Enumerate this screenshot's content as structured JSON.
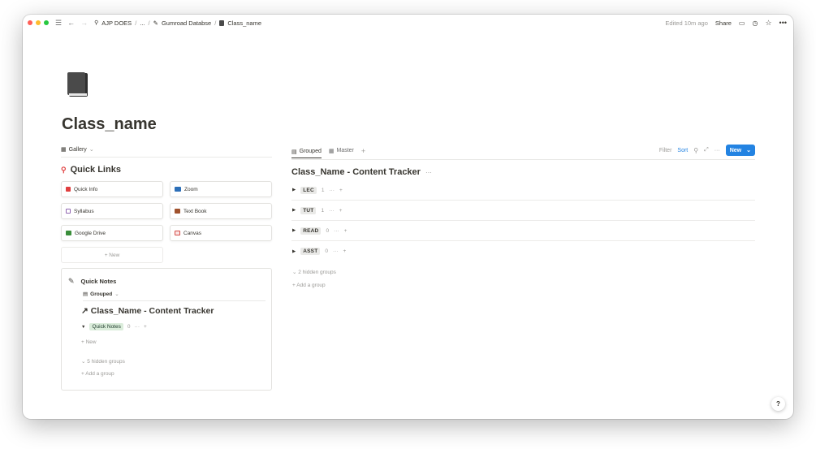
{
  "breadcrumb": [
    "AJP DOES",
    "...",
    "Gumroad Databse",
    "Class_name"
  ],
  "topbar": {
    "edited": "Edited 10m ago",
    "share": "Share"
  },
  "page": {
    "title": "Class_name"
  },
  "left": {
    "view_label": "Gallery",
    "quick_links_title": "Quick Links",
    "cards": [
      {
        "label": "Quick Info",
        "icon": "red-book-icon",
        "color": "#e03e3e"
      },
      {
        "label": "Zoom",
        "icon": "video-camera-icon",
        "color": "#2d6fb8"
      },
      {
        "label": "Syllabus",
        "icon": "tram-icon",
        "color": "#9065b0"
      },
      {
        "label": "Text Book",
        "icon": "books-icon",
        "color": "#a0522d"
      },
      {
        "label": "Google Drive",
        "icon": "folder-icon",
        "color": "#3a8e3a"
      },
      {
        "label": "Canvas",
        "icon": "picture-frame-icon",
        "color": "#d44c47"
      }
    ],
    "new_label": "+ New",
    "quick_notes": {
      "title": "Quick Notes",
      "view_label": "Grouped",
      "db_title": "Class_Name - Content Tracker",
      "group_label": "Quick Notes",
      "group_count": "0",
      "new_label": "New",
      "hidden_groups": "5 hidden groups",
      "add_group": "Add a group"
    }
  },
  "right": {
    "tabs": [
      {
        "label": "Grouped",
        "active": true
      },
      {
        "label": "Master",
        "active": false
      }
    ],
    "tools": {
      "filter": "Filter",
      "sort": "Sort",
      "new_label": "New"
    },
    "title": "Class_Name - Content Tracker",
    "groups": [
      {
        "label": "LEC",
        "count": "1"
      },
      {
        "label": "TUT",
        "count": "1"
      },
      {
        "label": "READ",
        "count": "0"
      },
      {
        "label": "ASST",
        "count": "0"
      }
    ],
    "hidden_groups": "2 hidden groups",
    "add_group": "Add a group"
  },
  "help": "?"
}
